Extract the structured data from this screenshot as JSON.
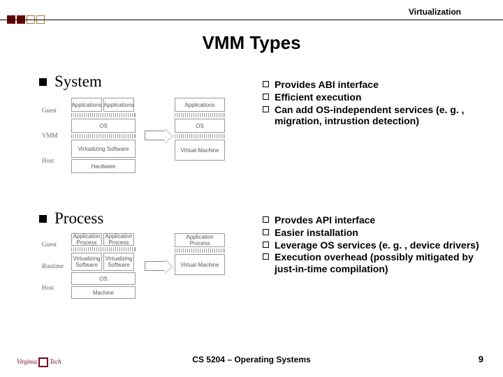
{
  "header": {
    "title": "Virtualization"
  },
  "slide": {
    "title": "VMM Types"
  },
  "sections": {
    "system": {
      "label": "System",
      "bullets": [
        "Provides ABI interface",
        "Efficient execution",
        "Can add OS-independent services (e. g. , migration, intrustion detection)"
      ],
      "diagram": {
        "rows": [
          "Guest",
          "VMM",
          "Host"
        ],
        "left": {
          "apps": "Applications",
          "os": "OS",
          "vmm": "Virtualizing Software",
          "hw": "Hardware"
        },
        "right": {
          "apps": "Applications",
          "os": "OS",
          "vm": "Virtual Machine"
        }
      }
    },
    "process": {
      "label": "Process",
      "bullets": [
        "Provdes API interface",
        "Easier installation",
        "Leverage OS services (e. g. , device drivers)",
        "Execution overhead (possibly mitigated by just-in-time compilation)"
      ],
      "diagram": {
        "rows": [
          "Guest",
          "Runtime",
          "Host"
        ],
        "left": {
          "app": "Application Process",
          "vmm": "Virtualizing Software",
          "os": "OS",
          "mach": "Machine"
        },
        "right": {
          "app": "Application Process",
          "vm": "Virtual Machine"
        }
      }
    }
  },
  "footer": {
    "logo_left": "Virginia",
    "logo_right": "Tech",
    "center": "CS 5204 – Operating Systems",
    "page": "9"
  }
}
